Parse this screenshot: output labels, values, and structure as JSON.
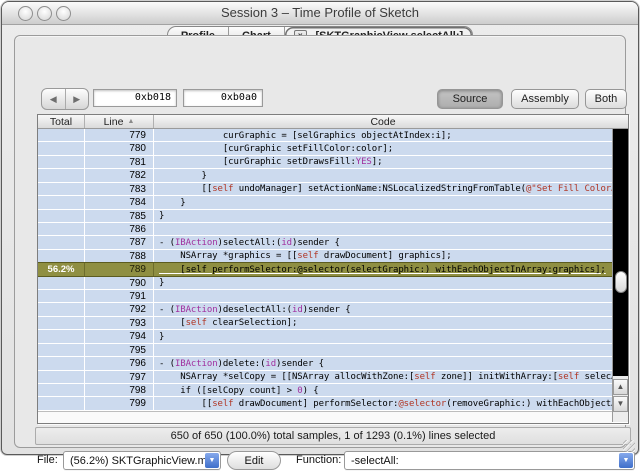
{
  "window": {
    "title": "Session 3 – Time Profile of Sketch"
  },
  "tabs": [
    {
      "label": "Profile",
      "selected": false
    },
    {
      "label": "Chart",
      "selected": false
    },
    {
      "label": "-[SKTGraphicView selectAll:]",
      "selected": true,
      "closable": true,
      "close_glyph": "x"
    }
  ],
  "toolbar": {
    "back_icon": "◀",
    "forward_icon": "▶",
    "address_fields": {
      "first": "0xb018",
      "second": "0xb0a0"
    },
    "view_buttons": [
      {
        "label": "Source",
        "selected": true
      },
      {
        "label": "Assembly",
        "selected": false
      },
      {
        "label": "Both",
        "selected": false
      }
    ]
  },
  "table": {
    "columns": [
      "Total",
      "Line",
      "Code"
    ],
    "sort_indicator": "▲",
    "rows": [
      {
        "line": "779",
        "seg": [
          [
            "p",
            "            curGraphic = [selGraphics objectAtIndex:i];"
          ]
        ]
      },
      {
        "line": "780",
        "seg": [
          [
            "p",
            "            [curGraphic setFillColor:color];"
          ]
        ]
      },
      {
        "line": "781",
        "seg": [
          [
            "p",
            "            [curGraphic setDrawsFill:"
          ],
          [
            "m",
            "YES"
          ],
          [
            "p",
            "];"
          ]
        ]
      },
      {
        "line": "782",
        "seg": [
          [
            "p",
            "        }"
          ]
        ]
      },
      {
        "line": "783",
        "seg": [
          [
            "p",
            "        [["
          ],
          [
            "r",
            "self"
          ],
          [
            "p",
            " undoManager] setActionName:NSLocalizedStringFromTable("
          ],
          [
            "r",
            "@\"Set Fill Color…"
          ]
        ]
      },
      {
        "line": "784",
        "seg": [
          [
            "p",
            "    }"
          ]
        ]
      },
      {
        "line": "785",
        "seg": [
          [
            "p",
            "}"
          ]
        ]
      },
      {
        "line": "786",
        "seg": []
      },
      {
        "line": "787",
        "seg": [
          [
            "p",
            "- ("
          ],
          [
            "m",
            "IBAction"
          ],
          [
            "p",
            ")selectAll:("
          ],
          [
            "m",
            "id"
          ],
          [
            "p",
            ")sender {"
          ]
        ]
      },
      {
        "line": "788",
        "seg": [
          [
            "p",
            "    NSArray *graphics = [["
          ],
          [
            "r",
            "self"
          ],
          [
            "p",
            " drawDocument] graphics];"
          ]
        ]
      },
      {
        "line": "789",
        "total": "56.2%",
        "highlight": true,
        "seg": [
          [
            "p",
            "    [self performSelector:@selector(selectGraphic:) withEachObjectInArray:graphics];"
          ]
        ]
      },
      {
        "line": "790",
        "seg": [
          [
            "p",
            "}"
          ]
        ]
      },
      {
        "line": "791",
        "seg": []
      },
      {
        "line": "792",
        "seg": [
          [
            "p",
            "- ("
          ],
          [
            "m",
            "IBAction"
          ],
          [
            "p",
            ")deselectAll:("
          ],
          [
            "m",
            "id"
          ],
          [
            "p",
            ")sender {"
          ]
        ]
      },
      {
        "line": "793",
        "seg": [
          [
            "p",
            "    ["
          ],
          [
            "r",
            "self"
          ],
          [
            "p",
            " clearSelection];"
          ]
        ]
      },
      {
        "line": "794",
        "seg": [
          [
            "p",
            "}"
          ]
        ]
      },
      {
        "line": "795",
        "seg": []
      },
      {
        "line": "796",
        "seg": [
          [
            "p",
            "- ("
          ],
          [
            "m",
            "IBAction"
          ],
          [
            "p",
            ")delete:("
          ],
          [
            "m",
            "id"
          ],
          [
            "p",
            ")sender {"
          ]
        ]
      },
      {
        "line": "797",
        "seg": [
          [
            "p",
            "    NSArray *selCopy = [[NSArray allocWithZone:["
          ],
          [
            "r",
            "self"
          ],
          [
            "p",
            " zone]] initWithArray:["
          ],
          [
            "r",
            "self"
          ],
          [
            "p",
            " selec…"
          ]
        ]
      },
      {
        "line": "798",
        "seg": [
          [
            "p",
            "    if ([selCopy count] > "
          ],
          [
            "m",
            "0"
          ],
          [
            "p",
            ") {"
          ]
        ]
      },
      {
        "line": "799",
        "seg": [
          [
            "p",
            "        [["
          ],
          [
            "r",
            "self"
          ],
          [
            "p",
            " drawDocument] performSelector:"
          ],
          [
            "r",
            "@selector"
          ],
          [
            "p",
            "(removeGraphic:) withEachObject…"
          ]
        ]
      }
    ]
  },
  "scrollbar": {
    "up_icon": "▲",
    "down_icon": "▼"
  },
  "statusbar": {
    "text": "650 of 650 (100.0%) total samples, 1 of 1293 (0.1%) lines selected"
  },
  "footer": {
    "file_label": "File:",
    "file_value": "(56.2%) SKTGraphicView.m",
    "edit_label": "Edit",
    "function_label": "Function:",
    "function_value": "-selectAll:",
    "popup_arrow": "▼"
  },
  "colors": {
    "row_blue": "#ccdaee",
    "highlight_olive": "#8f8f42",
    "keyword_magenta": "#a0309f",
    "self_red": "#b03524",
    "popup_accent_blue": "#3f6fca",
    "scroll_track_black": "#000000"
  }
}
